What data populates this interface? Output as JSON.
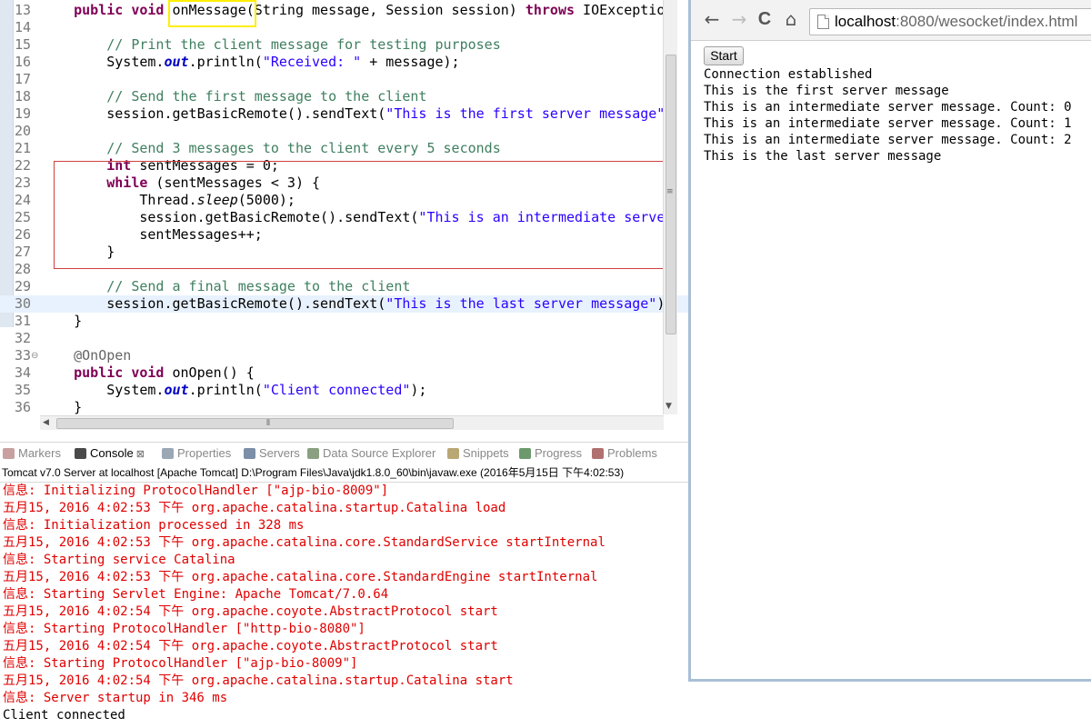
{
  "editor": {
    "lines": [
      {
        "num": "13",
        "segs": [
          {
            "t": "    "
          },
          {
            "c": "kw",
            "t": "public"
          },
          {
            "t": " "
          },
          {
            "c": "kw",
            "t": "void"
          },
          {
            "t": " onMessage(String message, Session session) "
          },
          {
            "c": "kw",
            "t": "throws"
          },
          {
            "t": " IOExceptio"
          }
        ]
      },
      {
        "num": "14",
        "segs": []
      },
      {
        "num": "15",
        "segs": [
          {
            "t": "        "
          },
          {
            "c": "cm",
            "t": "// Print the client message for testing purposes"
          }
        ]
      },
      {
        "num": "16",
        "segs": [
          {
            "t": "        System."
          },
          {
            "c": "fd",
            "t": "out"
          },
          {
            "t": ".println("
          },
          {
            "c": "st",
            "t": "\"Received: \""
          },
          {
            "t": " + message);"
          }
        ]
      },
      {
        "num": "17",
        "segs": []
      },
      {
        "num": "18",
        "segs": [
          {
            "t": "        "
          },
          {
            "c": "cm",
            "t": "// Send the first message to the client"
          }
        ]
      },
      {
        "num": "19",
        "segs": [
          {
            "t": "        session.getBasicRemote().sendText("
          },
          {
            "c": "st",
            "t": "\"This is the first server message\""
          }
        ]
      },
      {
        "num": "20",
        "segs": []
      },
      {
        "num": "21",
        "segs": [
          {
            "t": "        "
          },
          {
            "c": "cm",
            "t": "// Send 3 messages to the client every 5 seconds"
          }
        ]
      },
      {
        "num": "22",
        "segs": [
          {
            "t": "        "
          },
          {
            "c": "kw",
            "t": "int"
          },
          {
            "t": " sentMessages = 0;"
          }
        ]
      },
      {
        "num": "23",
        "segs": [
          {
            "t": "        "
          },
          {
            "c": "kw",
            "t": "while"
          },
          {
            "t": " (sentMessages < 3) {"
          }
        ]
      },
      {
        "num": "24",
        "segs": [
          {
            "t": "            Thread."
          },
          {
            "c": "it",
            "t": "sleep"
          },
          {
            "t": "(5000);"
          }
        ]
      },
      {
        "num": "25",
        "segs": [
          {
            "t": "            session.getBasicRemote().sendText("
          },
          {
            "c": "st",
            "t": "\"This is an intermediate serve"
          }
        ]
      },
      {
        "num": "26",
        "segs": [
          {
            "t": "            sentMessages++;"
          }
        ]
      },
      {
        "num": "27",
        "segs": [
          {
            "t": "        }"
          }
        ]
      },
      {
        "num": "28",
        "segs": []
      },
      {
        "num": "29",
        "segs": [
          {
            "t": "        "
          },
          {
            "c": "cm",
            "t": "// Send a final message to the client"
          }
        ]
      },
      {
        "num": "30",
        "segs": [
          {
            "t": "        session.getBasicRemote().sendText("
          },
          {
            "c": "st",
            "t": "\"This is the last server message\""
          },
          {
            "t": ")"
          }
        ]
      },
      {
        "num": "31",
        "segs": [
          {
            "t": "    }"
          }
        ]
      },
      {
        "num": "32",
        "segs": []
      },
      {
        "num": "33",
        "segs": [
          {
            "t": "    "
          },
          {
            "c": "an",
            "t": "@OnOpen"
          }
        ]
      },
      {
        "num": "34",
        "segs": [
          {
            "t": "    "
          },
          {
            "c": "kw",
            "t": "public"
          },
          {
            "t": " "
          },
          {
            "c": "kw",
            "t": "void"
          },
          {
            "t": " onOpen() {"
          }
        ]
      },
      {
        "num": "35",
        "segs": [
          {
            "t": "        System."
          },
          {
            "c": "fd",
            "t": "out"
          },
          {
            "t": ".println("
          },
          {
            "c": "st",
            "t": "\"Client connected\""
          },
          {
            "t": ");"
          }
        ]
      },
      {
        "num": "36",
        "segs": [
          {
            "t": "    }"
          }
        ]
      }
    ],
    "current_line_index": 17,
    "fold_marker_index": 20,
    "fold_marker_glyph": "⊖"
  },
  "views": {
    "tabs": [
      {
        "label": "Markers",
        "icon": "markers-icon",
        "active": false
      },
      {
        "label": "Console",
        "icon": "console-icon",
        "active": true,
        "close": "⊠"
      },
      {
        "label": "Properties",
        "icon": "properties-icon",
        "active": false
      },
      {
        "label": "Servers",
        "icon": "servers-icon",
        "active": false
      },
      {
        "label": "Data Source Explorer",
        "icon": "data-source-icon",
        "active": false
      },
      {
        "label": "Snippets",
        "icon": "snippets-icon",
        "active": false
      },
      {
        "label": "Progress",
        "icon": "progress-icon",
        "active": false
      },
      {
        "label": "Problems",
        "icon": "problems-icon",
        "active": false
      }
    ],
    "console_title": "Tomcat v7.0 Server at localhost [Apache Tomcat] D:\\Program Files\\Java\\jdk1.8.0_60\\bin\\javaw.exe (2016年5月15日 下午4:02:53)"
  },
  "console": {
    "lines": [
      {
        "text": "信息: Initializing ProtocolHandler [\"ajp-bio-8009\"]",
        "err": true
      },
      {
        "text": "五月15, 2016 4:02:53 下午 org.apache.catalina.startup.Catalina load",
        "err": true
      },
      {
        "text": "信息: Initialization processed in 328 ms",
        "err": true
      },
      {
        "text": "五月15, 2016 4:02:53 下午 org.apache.catalina.core.StandardService startInternal",
        "err": true
      },
      {
        "text": "信息: Starting service Catalina",
        "err": true
      },
      {
        "text": "五月15, 2016 4:02:53 下午 org.apache.catalina.core.StandardEngine startInternal",
        "err": true
      },
      {
        "text": "信息: Starting Servlet Engine: Apache Tomcat/7.0.64",
        "err": true
      },
      {
        "text": "五月15, 2016 4:02:54 下午 org.apache.coyote.AbstractProtocol start",
        "err": true
      },
      {
        "text": "信息: Starting ProtocolHandler [\"http-bio-8080\"]",
        "err": true
      },
      {
        "text": "五月15, 2016 4:02:54 下午 org.apache.coyote.AbstractProtocol start",
        "err": true
      },
      {
        "text": "信息: Starting ProtocolHandler [\"ajp-bio-8009\"]",
        "err": true
      },
      {
        "text": "五月15, 2016 4:02:54 下午 org.apache.catalina.startup.Catalina start",
        "err": true
      },
      {
        "text": "信息: Server startup in 346 ms",
        "err": true
      },
      {
        "text": "Client connected",
        "err": false
      }
    ]
  },
  "browser": {
    "back_icon": "←",
    "forward_icon": "→",
    "reload_icon": "C",
    "home_icon": "⌂",
    "url_host": "localhost",
    "url_rest": ":8080/wesocket/index.html",
    "start_label": "Start",
    "messages": [
      "Connection established",
      "This is the first server message",
      "This is an intermediate server message. Count: 0",
      "This is an intermediate server message. Count: 1",
      "This is an intermediate server message. Count: 2",
      "This is the last server message"
    ]
  },
  "colors": {
    "keyword": "#7f0055",
    "comment": "#3f7f5f",
    "string": "#2a00ff",
    "field": "#0000c0",
    "stderr": "#e00000",
    "highlight_box": "#ffee00",
    "selection_box": "#d04040"
  }
}
